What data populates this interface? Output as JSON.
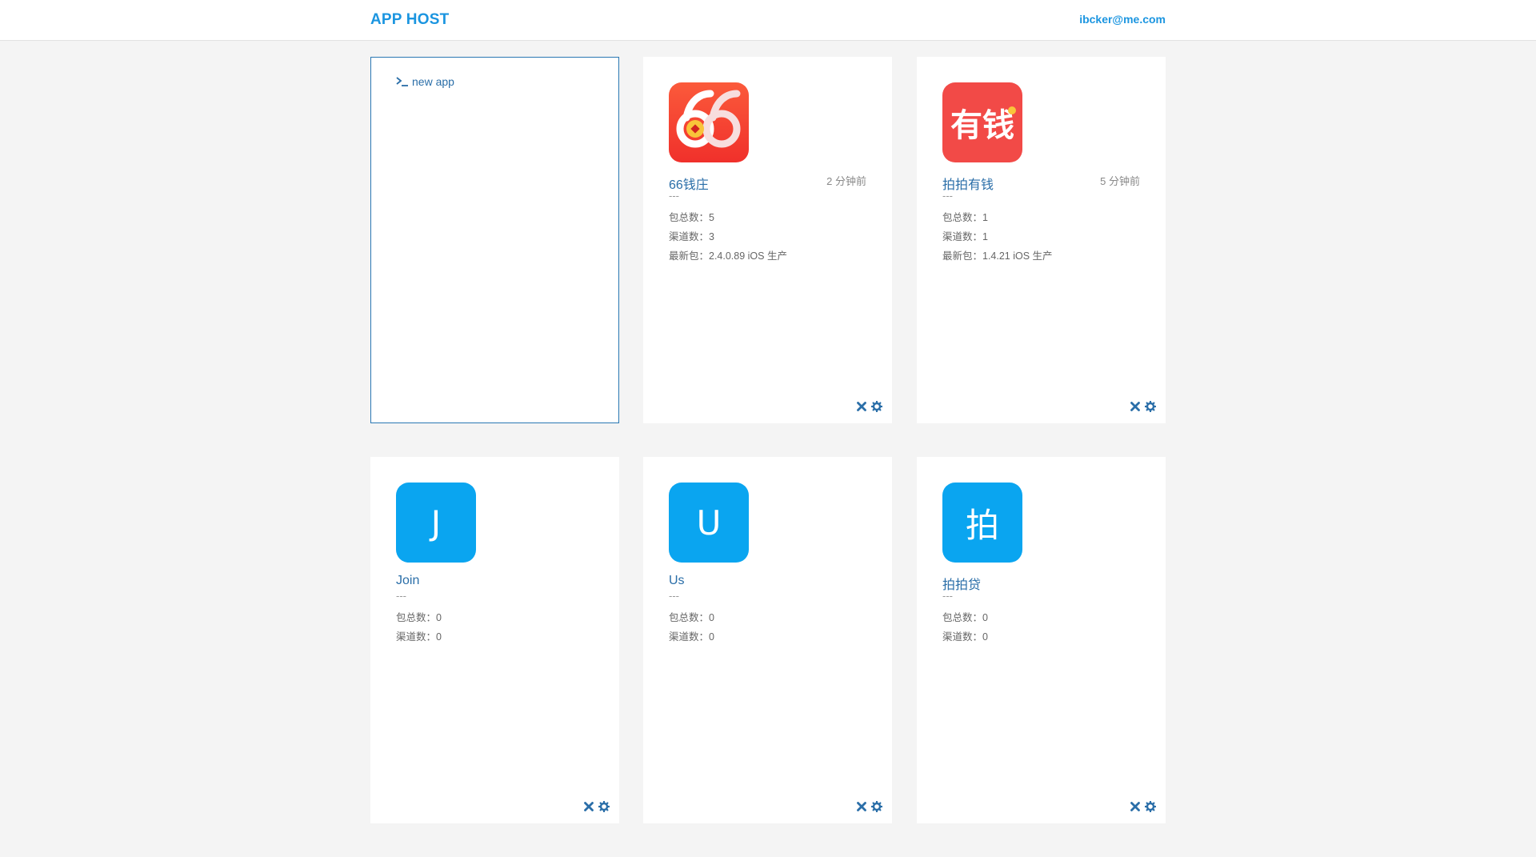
{
  "header": {
    "brand": "APP HOST",
    "user_email": "ibcker@me.com"
  },
  "new_app": {
    "label": "new app",
    "icon": "terminal-prompt-icon"
  },
  "colors": {
    "accent": "#1b95e0",
    "link": "#2a6ea8",
    "icon_blue": "#0aa5f0",
    "icon_red": "#f23d36"
  },
  "apps": [
    {
      "name": "66钱庄",
      "updated": "2 分钟前",
      "desc": "---",
      "packages": "包总数：5",
      "channels": "渠道数：3",
      "latest": "最新包：2.4.0.89 iOS 生产",
      "icon": "logo-66-icon"
    },
    {
      "name": "拍拍有钱",
      "updated": "5 分钟前",
      "desc": "---",
      "packages": "包总数：1",
      "channels": "渠道数：1",
      "latest": "最新包：1.4.21 iOS 生产",
      "icon_text": "有钱",
      "icon": "logo-youqian-icon"
    },
    {
      "name": "Join",
      "desc": "---",
      "packages": "包总数：0",
      "channels": "渠道数：0",
      "icon_text": "J",
      "icon": "letter-avatar-icon"
    },
    {
      "name": "Us",
      "desc": "---",
      "packages": "包总数：0",
      "channels": "渠道数：0",
      "icon_text": "U",
      "icon": "letter-avatar-icon"
    },
    {
      "name": "拍拍贷",
      "desc": "---",
      "packages": "包总数：0",
      "channels": "渠道数：0",
      "icon_text": "拍",
      "icon": "letter-avatar-icon"
    }
  ]
}
